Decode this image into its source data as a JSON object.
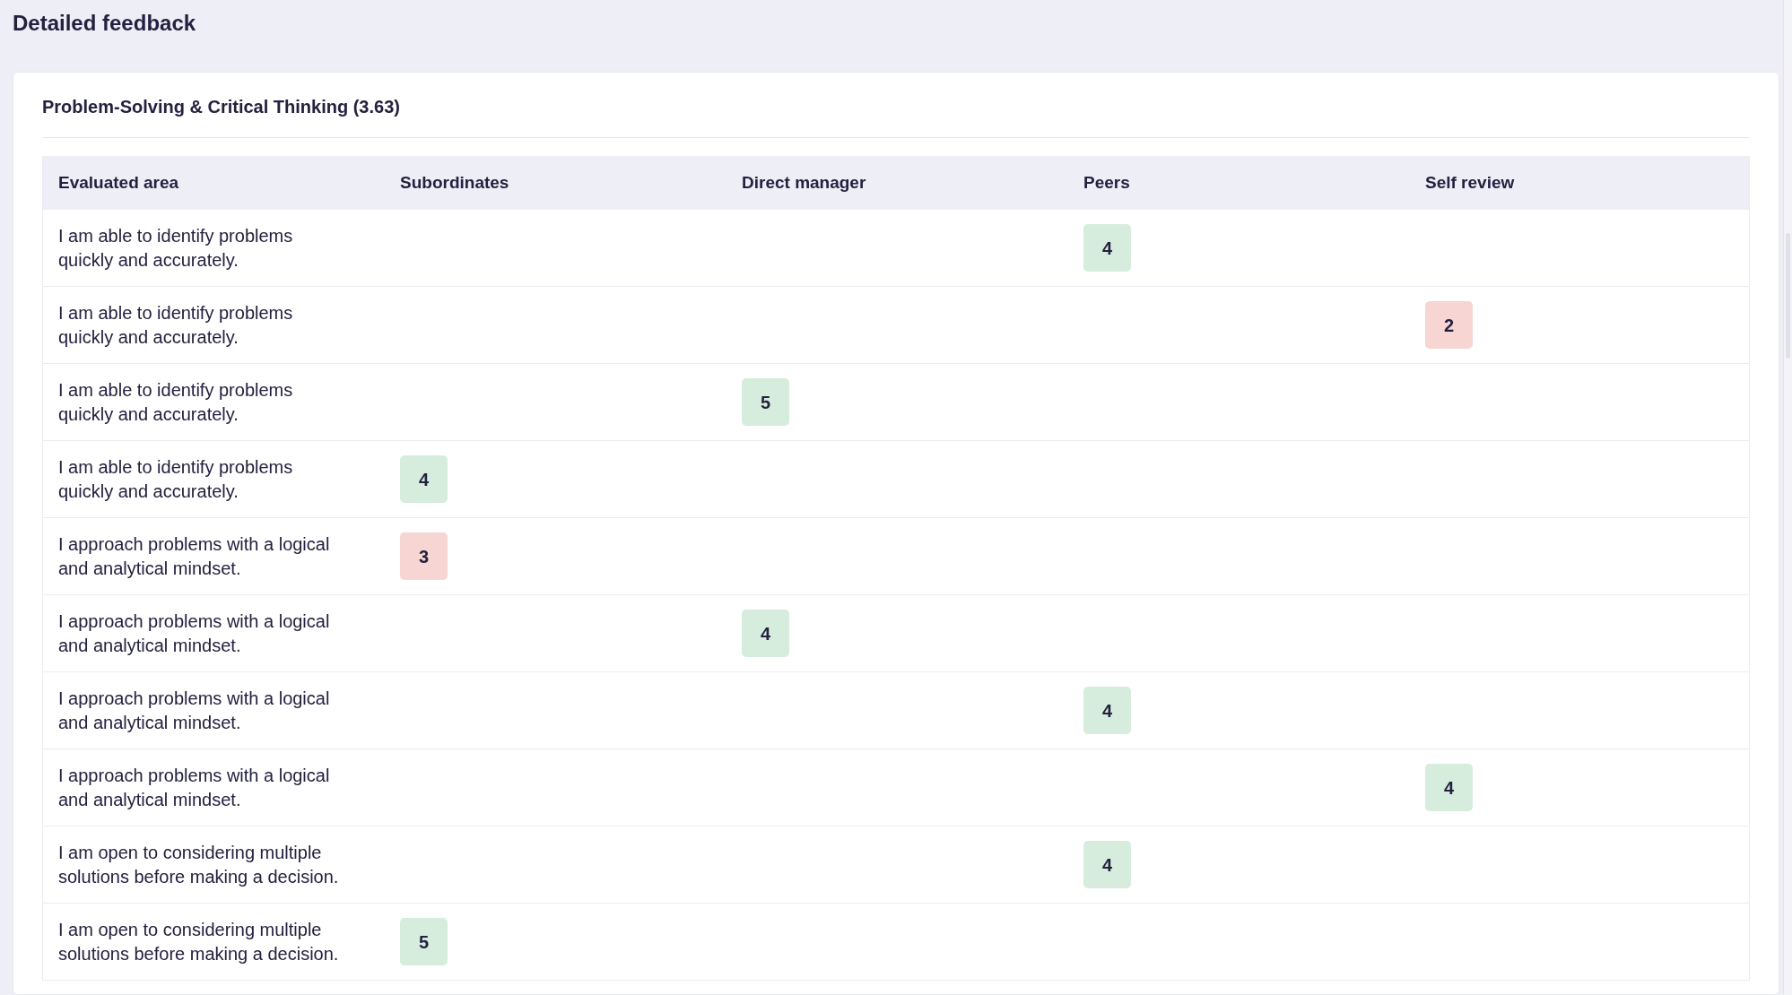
{
  "page_title": "Detailed feedback",
  "section": {
    "title": "Problem-Solving & Critical Thinking (3.63)",
    "table": {
      "columns": [
        "Evaluated area",
        "Subordinates",
        "Direct manager",
        "Peers",
        "Self review"
      ],
      "rows": [
        {
          "cells": [
            "I am able to identify problems quickly and accurately.",
            "",
            "",
            {
              "value": "4",
              "color": "#d6eddd"
            },
            ""
          ]
        },
        {
          "cells": [
            "I am able to identify problems quickly and accurately.",
            "",
            "",
            "",
            {
              "value": "2",
              "color": "#f6d5d2"
            }
          ]
        },
        {
          "cells": [
            "I am able to identify problems quickly and accurately.",
            "",
            {
              "value": "5",
              "color": "#d6eddd"
            },
            "",
            ""
          ]
        },
        {
          "cells": [
            "I am able to identify problems quickly and accurately.",
            {
              "value": "4",
              "color": "#d6eddd"
            },
            "",
            "",
            ""
          ]
        },
        {
          "cells": [
            "I approach problems with a logical and analytical mindset.",
            {
              "value": "3",
              "color": "#f6d5d2"
            },
            "",
            "",
            ""
          ]
        },
        {
          "cells": [
            "I approach problems with a logical and analytical mindset.",
            "",
            {
              "value": "4",
              "color": "#d6eddd"
            },
            "",
            ""
          ]
        },
        {
          "cells": [
            "I approach problems with a logical and analytical mindset.",
            "",
            "",
            {
              "value": "4",
              "color": "#d6eddd"
            },
            ""
          ]
        },
        {
          "cells": [
            "I approach problems with a logical and analytical mindset.",
            "",
            "",
            "",
            {
              "value": "4",
              "color": "#d6eddd"
            }
          ]
        },
        {
          "cells": [
            "I am open to considering multiple solutions before making a decision.",
            "",
            "",
            {
              "value": "4",
              "color": "#d6eddd"
            },
            ""
          ]
        },
        {
          "cells": [
            "I am open to considering multiple solutions before making a decision.",
            {
              "value": "5",
              "color": "#d6eddd"
            },
            "",
            "",
            ""
          ]
        }
      ]
    }
  }
}
